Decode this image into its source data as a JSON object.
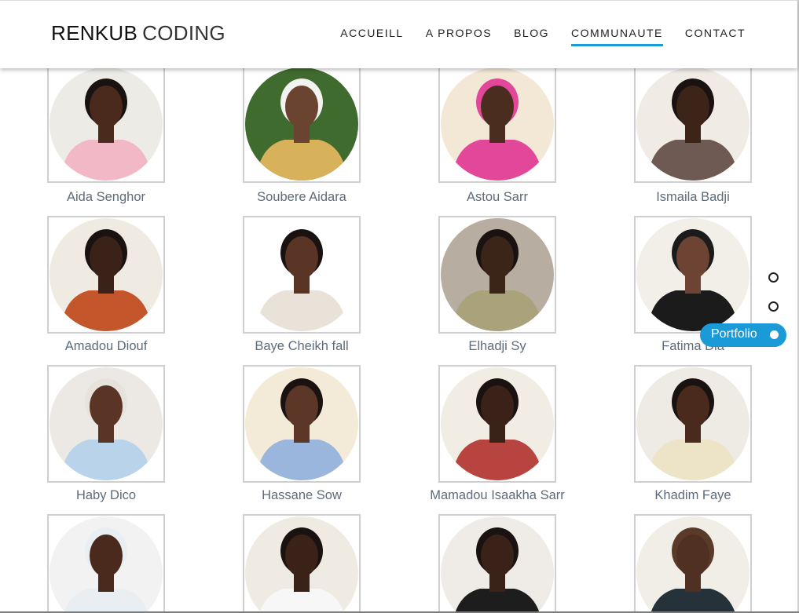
{
  "header": {
    "logo_bold": "RENKUB",
    "logo_light": "CODING",
    "nav": [
      "ACCUEILL",
      "A PROPOS",
      "BLOG",
      "COMMUNAUTE",
      "CONTACT"
    ],
    "active_nav": "COMMUNAUTE"
  },
  "members": [
    {
      "name": "Aida Senghor",
      "bg": "#ecebe6",
      "skin": "#4a2a1c",
      "cloth": "#f2b8c6",
      "hair": "#1a1210"
    },
    {
      "name": "Soubere Aidara",
      "bg": "#3f6b2e",
      "skin": "#6b4431",
      "cloth": "#d8b25a",
      "hair": "#f2f2ee"
    },
    {
      "name": "Astou Sarr",
      "bg": "#f3e8d6",
      "skin": "#4b2d1f",
      "cloth": "#e2479a",
      "hair": "#e2479a"
    },
    {
      "name": "Ismaila Badji",
      "bg": "#f0ebe4",
      "skin": "#3d2419",
      "cloth": "#6e5a52",
      "hair": "#1a1210"
    },
    {
      "name": "Amadou Diouf",
      "bg": "#efebe3",
      "skin": "#3a2219",
      "cloth": "#c4562b",
      "hair": "#1a1210"
    },
    {
      "name": "Baye Cheikh fall",
      "bg": "#ffffff",
      "skin": "#5a3526",
      "cloth": "#e9e2d8",
      "hair": "#1a1210"
    },
    {
      "name": "Elhadji Sy",
      "bg": "#b7ada1",
      "skin": "#3b2418",
      "cloth": "#a9a27a",
      "hair": "#1a1210"
    },
    {
      "name": "Fatima Dia",
      "bg": "#f2eee8",
      "skin": "#6d4433",
      "cloth": "#1b1b1b",
      "hair": "#1b1b1b"
    },
    {
      "name": "Haby Dico",
      "bg": "#ece9e4",
      "skin": "#5a3424",
      "cloth": "#b9d3ea",
      "hair": "#e8e2dc"
    },
    {
      "name": "Hassane Sow",
      "bg": "#f3ead8",
      "skin": "#5c3626",
      "cloth": "#9bb6dd",
      "hair": "#1a1210"
    },
    {
      "name": "Mamadou Isaakha Sarr",
      "bg": "#f1ece4",
      "skin": "#3b2218",
      "cloth": "#b8443f",
      "hair": "#1a1210"
    },
    {
      "name": "Khadim Faye",
      "bg": "#eeeae4",
      "skin": "#4a2a1d",
      "cloth": "#ede4c8",
      "hair": "#1a1210"
    },
    {
      "name": "",
      "bg": "#f2f2f2",
      "skin": "#4a2a1d",
      "cloth": "#e9eef2",
      "hair": "#e9eef2"
    },
    {
      "name": "",
      "bg": "#efeae2",
      "skin": "#3b2218",
      "cloth": "#f7f7f7",
      "hair": "#1a1210"
    },
    {
      "name": "",
      "bg": "#efebe6",
      "skin": "#3b2218",
      "cloth": "#1d1d1d",
      "hair": "#1a1210"
    },
    {
      "name": "",
      "bg": "#f1ede7",
      "skin": "#4f3022",
      "cloth": "#26323a",
      "hair": "#5a3b2a"
    }
  ],
  "side_nav": {
    "active_label": "Portfolio"
  }
}
